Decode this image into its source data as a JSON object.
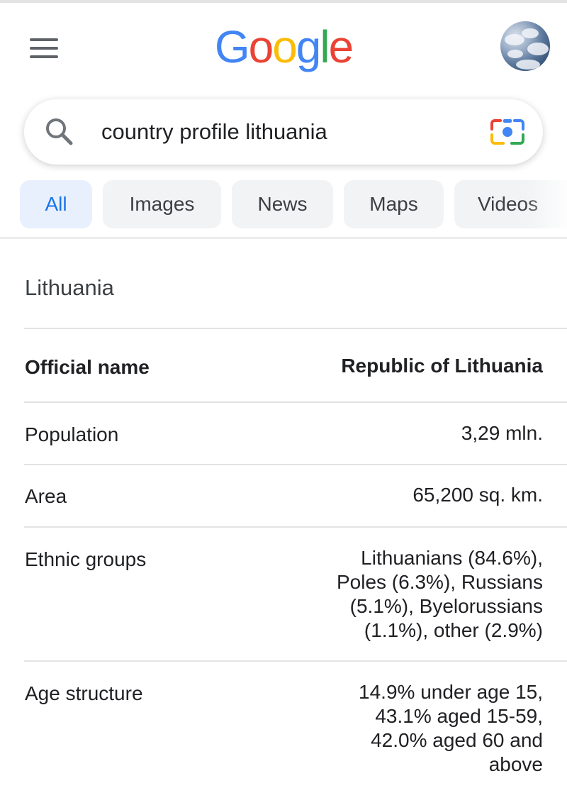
{
  "header": {
    "logo_text": "Google",
    "logo_letters": [
      {
        "ch": "G",
        "color": "#4285F4"
      },
      {
        "ch": "o",
        "color": "#EA4335"
      },
      {
        "ch": "o",
        "color": "#FBBC05"
      },
      {
        "ch": "g",
        "color": "#4285F4"
      },
      {
        "ch": "l",
        "color": "#34A853"
      },
      {
        "ch": "e",
        "color": "#EA4335"
      }
    ],
    "menu_icon": "hamburger-menu-icon",
    "avatar_icon": "profile-avatar"
  },
  "search": {
    "query": "country profile lithuania",
    "search_icon": "search-icon",
    "lens_icon": "google-lens-camera-icon"
  },
  "tabs": [
    {
      "label": "All",
      "active": true
    },
    {
      "label": "Images",
      "active": false
    },
    {
      "label": "News",
      "active": false
    },
    {
      "label": "Maps",
      "active": false
    },
    {
      "label": "Videos",
      "active": false
    }
  ],
  "card": {
    "title": "Lithuania",
    "rows": [
      {
        "label": "Official name",
        "value": "Republic of Lithuania"
      },
      {
        "label": "Population",
        "value": "3,29 mln."
      },
      {
        "label": "Area",
        "value": "65,200 sq. km."
      },
      {
        "label": "Ethnic groups",
        "value": "Lithuanians (84.6%), Poles (6.3%), Russians (5.1%), Byelorussians (1.1%), other (2.9%)"
      },
      {
        "label": "Age structure",
        "value": "14.9% under age 15, 43.1% aged 15-59, 42.0% aged 60 and above"
      }
    ]
  },
  "colors": {
    "accent": "#1a73e8",
    "active_tab_bg": "#e8f0fe",
    "tab_bg": "#f1f3f4",
    "divider": "#e2e3e5"
  }
}
